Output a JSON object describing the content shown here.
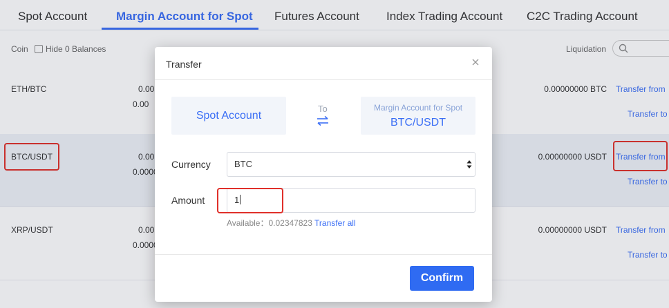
{
  "tabs": [
    {
      "label": "Spot Account"
    },
    {
      "label": "Margin Account for Spot",
      "active": true
    },
    {
      "label": "Futures Account"
    },
    {
      "label": "Index Trading Account"
    },
    {
      "label": "C2C Trading Account"
    }
  ],
  "table_header": {
    "coin": "Coin",
    "hide_zero": "Hide 0 Balances",
    "liquidation": "Liquidation"
  },
  "rows": [
    {
      "pair": "ETH/BTC",
      "num1": "0.00",
      "num2": "0.00",
      "liquidation": "0.00000000 BTC",
      "transfer_from": "Transfer from",
      "transfer_to": "Transfer to"
    },
    {
      "pair": "BTC/USDT",
      "num1": "0.00",
      "num2": "0.0000",
      "liquidation": "0.00000000 USDT",
      "transfer_from": "Transfer from",
      "transfer_to": "Transfer to"
    },
    {
      "pair": "XRP/USDT",
      "num1": "0.00",
      "num2": "0.0000",
      "liquidation": "0.00000000 USDT",
      "transfer_from": "Transfer from",
      "transfer_to": "Transfer to"
    }
  ],
  "modal": {
    "title": "Transfer",
    "from_account": "Spot Account",
    "to_label": "To",
    "to_account_type": "Margin Account for Spot",
    "to_account_pair": "BTC/USDT",
    "currency_label": "Currency",
    "currency_value": "BTC",
    "amount_label": "Amount",
    "amount_value": "1",
    "available_label": "Available：0.02347823",
    "transfer_all": "Transfer all",
    "confirm": "Confirm"
  },
  "colors": {
    "accent": "#3a6ef5",
    "highlight_box": "#e0302a",
    "confirm_bg": "#2f6bf2"
  }
}
